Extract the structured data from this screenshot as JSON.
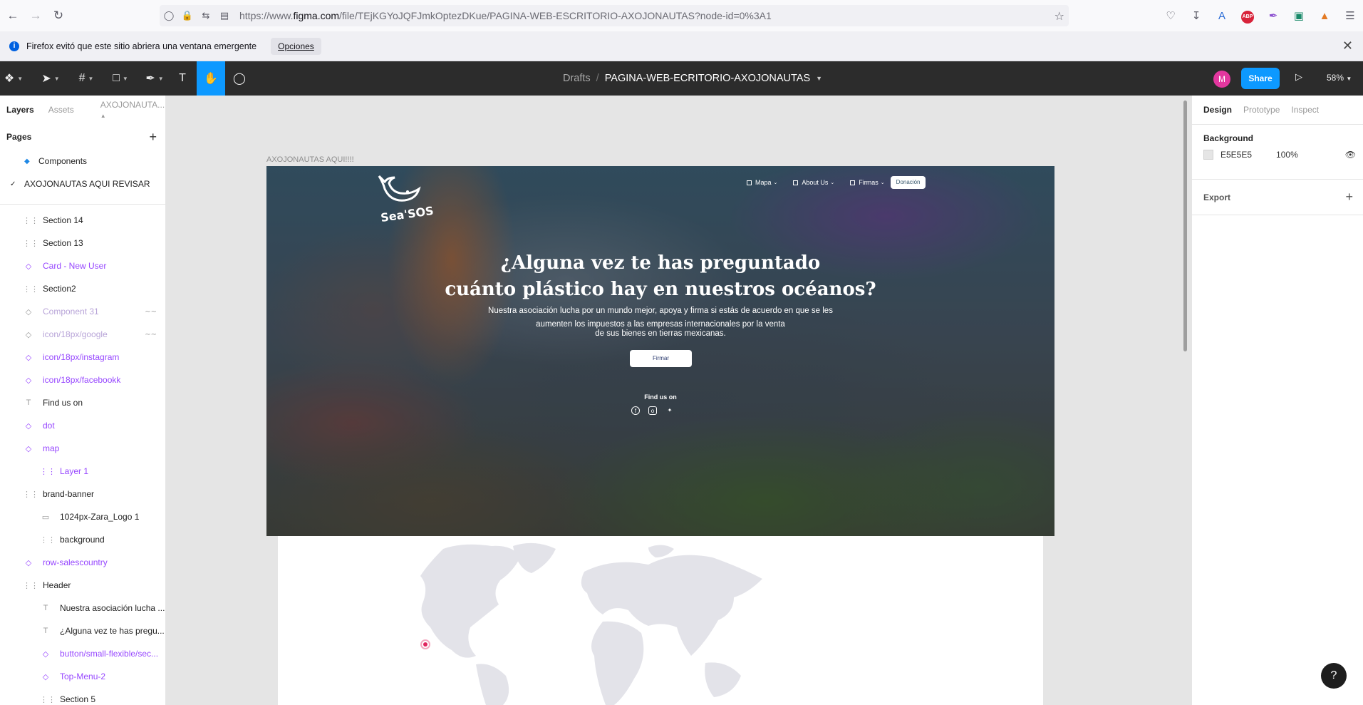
{
  "browser": {
    "url_prefix": "https://www.",
    "url_host": "figma.com",
    "url_path": "/file/TEjKGYoJQFJmkOptezDKue/PAGINA-WEB-ESCRITORIO-AXOJONAUTAS?node-id=0%3A1",
    "icons": [
      "back-icon",
      "forward-icon",
      "reload-icon",
      "shield-icon",
      "lock-icon",
      "permissions-icon",
      "page-icon",
      "star-icon",
      "pocket-icon",
      "download-icon",
      "translate-icon",
      "abp-icon",
      "pen-icon",
      "extension-icon",
      "fox-icon",
      "menu-icon"
    ],
    "abp_label": "ABP"
  },
  "notification": {
    "message": "Firefox evitó que este sitio abriera una ventana emergente",
    "button": "Opciones"
  },
  "figma_toolbar": {
    "breadcrumb_drafts": "Drafts",
    "breadcrumb_sep": "/",
    "file_name": "PAGINA-WEB-ECRITORIO-AXOJONAUTAS",
    "avatar_initial": "M",
    "share_label": "Share",
    "zoom": "58%"
  },
  "left_panel": {
    "tabs": [
      "Layers",
      "Assets"
    ],
    "file_tab": "AXOJONAUTA...",
    "pages_heading": "Pages",
    "pages": [
      {
        "label": "Components"
      },
      {
        "label": "AXOJONAUTAS AQUI REVISAR"
      }
    ],
    "layers": [
      {
        "label": "Section 14",
        "icon": "frame-icon"
      },
      {
        "label": "Section 13",
        "icon": "frame-icon"
      },
      {
        "label": "Card - New User",
        "icon": "component-instance-icon"
      },
      {
        "label": "Section2",
        "icon": "frame-icon"
      },
      {
        "label": "Component 31",
        "icon": "component-instance-icon"
      },
      {
        "label": "icon/18px/google",
        "icon": "component-instance-icon"
      },
      {
        "label": "icon/18px/instagram",
        "icon": "component-instance-icon"
      },
      {
        "label": "icon/18px/facebookk",
        "icon": "component-instance-icon"
      },
      {
        "label": "Find us on",
        "icon": "text-icon"
      },
      {
        "label": "dot",
        "icon": "component-instance-icon"
      },
      {
        "label": "map",
        "icon": "component-instance-icon"
      },
      {
        "label": "Layer 1",
        "icon": "frame-icon"
      },
      {
        "label": "brand-banner",
        "icon": "frame-icon"
      },
      {
        "label": "1024px-Zara_Logo 1",
        "icon": "image-icon"
      },
      {
        "label": "background",
        "icon": "frame-icon"
      },
      {
        "label": "row-salescountry",
        "icon": "component-instance-icon"
      },
      {
        "label": "Header",
        "icon": "frame-icon"
      },
      {
        "label": "Nuestra asociación lucha ...",
        "icon": "text-icon"
      },
      {
        "label": "¿Alguna vez te has pregu...",
        "icon": "text-icon"
      },
      {
        "label": "button/small-flexible/sec...",
        "icon": "component-instance-icon"
      },
      {
        "label": "Top-Menu-2",
        "icon": "component-instance-icon"
      },
      {
        "label": "Section 5",
        "icon": "frame-icon"
      }
    ]
  },
  "canvas": {
    "frame_label": "AXOJONAUTAS AQUI!!!!",
    "logo_text": "Sea'SOS",
    "nav": [
      "Mapa",
      "About Us",
      "Firmas"
    ],
    "nav_button": "Donación",
    "hero_title_1": "¿Alguna vez te has preguntado",
    "hero_title_2": "cuánto plástico hay en nuestros océanos?",
    "hero_sub_1": "Nuestra asociación lucha por un mundo mejor,  apoya y firma si estás de acuerdo en que se les",
    "hero_sub_2": "aumenten los impuestos a las empresas internacionales por la venta",
    "hero_sub_3": "de sus bienes en  tierras mexicanas.",
    "hero_button": "Firmar",
    "find_us": "Find us on",
    "social_icons": [
      "facebook-icon",
      "instagram-icon",
      "twitter-icon"
    ]
  },
  "right_panel": {
    "tabs": [
      "Design",
      "Prototype",
      "Inspect"
    ],
    "background_heading": "Background",
    "bg_hex": "E5E5E5",
    "bg_opacity": "100%",
    "export_heading": "Export"
  },
  "help": "?"
}
